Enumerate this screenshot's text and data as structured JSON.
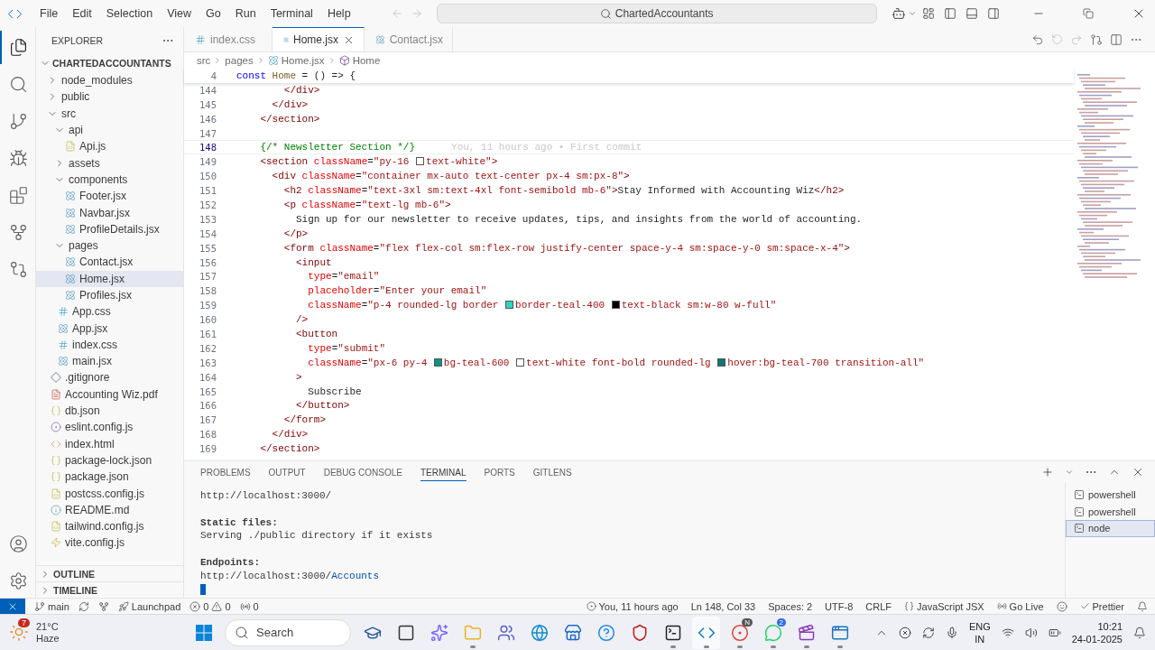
{
  "menu": [
    "File",
    "Edit",
    "Selection",
    "View",
    "Go",
    "Run",
    "Terminal",
    "Help"
  ],
  "command_center": {
    "value": "ChartedAccountants"
  },
  "activity_bar": [
    {
      "kind": "files",
      "selected": true
    },
    {
      "kind": "search",
      "selected": false
    },
    {
      "kind": "source-control",
      "selected": false
    },
    {
      "kind": "run",
      "selected": false
    },
    {
      "kind": "extensions",
      "selected": false
    },
    {
      "kind": "gitlens",
      "selected": false
    },
    {
      "kind": "graph",
      "selected": false
    }
  ],
  "explorer": {
    "title": "EXPLORER",
    "root": "CHARTEDACCOUNTANTS",
    "items": [
      {
        "name": "node_modules",
        "kind": "folder",
        "expanded": false,
        "selected": false
      },
      {
        "name": "public",
        "kind": "folder",
        "expanded": false,
        "selected": false
      },
      {
        "name": "src",
        "kind": "folder",
        "expanded": true,
        "selected": false,
        "children": [
          {
            "name": "api",
            "kind": "folder",
            "expanded": true,
            "selected": false,
            "children": [
              {
                "name": "Api.js",
                "kind": "js",
                "selected": false
              }
            ]
          },
          {
            "name": "assets",
            "kind": "folder",
            "expanded": false,
            "selected": false
          },
          {
            "name": "components",
            "kind": "folder",
            "expanded": true,
            "selected": false,
            "children": [
              {
                "name": "Footer.jsx",
                "kind": "react",
                "selected": false
              },
              {
                "name": "Navbar.jsx",
                "kind": "react",
                "selected": false
              },
              {
                "name": "ProfileDetails.jsx",
                "kind": "react",
                "selected": false
              }
            ]
          },
          {
            "name": "pages",
            "kind": "folder",
            "expanded": true,
            "selected": false,
            "children": [
              {
                "name": "Contact.jsx",
                "kind": "react",
                "selected": false
              },
              {
                "name": "Home.jsx",
                "kind": "react",
                "selected": true
              },
              {
                "name": "Profiles.jsx",
                "kind": "react",
                "selected": false
              }
            ]
          },
          {
            "name": "App.css",
            "kind": "css",
            "selected": false
          },
          {
            "name": "App.jsx",
            "kind": "react",
            "selected": false
          },
          {
            "name": "index.css",
            "kind": "css",
            "selected": false
          },
          {
            "name": "main.jsx",
            "kind": "react",
            "selected": false
          }
        ]
      },
      {
        "name": ".gitignore",
        "kind": "git",
        "selected": false
      },
      {
        "name": "Accounting Wiz.pdf",
        "kind": "pdf",
        "selected": false
      },
      {
        "name": "db.json",
        "kind": "json",
        "selected": false
      },
      {
        "name": "eslint.config.js",
        "kind": "eslint",
        "selected": false
      },
      {
        "name": "index.html",
        "kind": "html",
        "selected": false
      },
      {
        "name": "package-lock.json",
        "kind": "json",
        "selected": false
      },
      {
        "name": "package.json",
        "kind": "json",
        "selected": false
      },
      {
        "name": "postcss.config.js",
        "kind": "js",
        "selected": false
      },
      {
        "name": "README.md",
        "kind": "info",
        "selected": false
      },
      {
        "name": "tailwind.config.js",
        "kind": "js",
        "selected": false
      },
      {
        "name": "vite.config.js",
        "kind": "vite",
        "selected": false
      }
    ],
    "sections": [
      {
        "title": "OUTLINE",
        "expanded": false
      },
      {
        "title": "TIMELINE",
        "expanded": false
      }
    ]
  },
  "tabs": [
    {
      "label": "index.css",
      "kind": "css",
      "selected": false
    },
    {
      "label": "Home.jsx",
      "kind": "react",
      "selected": true
    },
    {
      "label": "Contact.jsx",
      "kind": "react",
      "selected": false
    }
  ],
  "breadcrumbs": [
    {
      "label": "src",
      "kind": "folder"
    },
    {
      "label": "pages",
      "kind": "folder"
    },
    {
      "label": "Home.jsx",
      "kind": "react"
    },
    {
      "label": "Home",
      "kind": "symbol"
    }
  ],
  "sticky_line": {
    "n": "4",
    "tokens": [
      {
        "kind": "kw",
        "text": "const "
      },
      {
        "kind": "fn",
        "text": "Home"
      },
      {
        "kind": "op",
        "text": " = () => {"
      }
    ]
  },
  "code": [
    {
      "n": "144",
      "current": false,
      "tokens": [
        {
          "kind": "tag",
          "text": "        </div>"
        }
      ]
    },
    {
      "n": "145",
      "current": false,
      "tokens": [
        {
          "kind": "tag",
          "text": "      </div>"
        }
      ]
    },
    {
      "n": "146",
      "current": false,
      "tokens": [
        {
          "kind": "tag",
          "text": "    </section>"
        }
      ]
    },
    {
      "n": "147",
      "current": false
    },
    {
      "n": "148",
      "current": true,
      "tokens": [
        {
          "kind": "comment",
          "text": "    {/* Newsletter Section */}"
        }
      ],
      "blame": "You, 11 hours ago • First commit"
    },
    {
      "n": "149",
      "current": false,
      "tokens": [
        {
          "kind": "tag",
          "text": "    <section"
        },
        {
          "kind": "attr",
          "text": " className"
        },
        {
          "kind": "op",
          "text": "="
        },
        {
          "kind": "str",
          "text": "\"py-16 "
        },
        {
          "kind": "swatch",
          "color": "#ffffff"
        },
        {
          "kind": "str",
          "text": "text-white\""
        },
        {
          "kind": "tag",
          "text": ">"
        }
      ]
    },
    {
      "n": "150",
      "current": false,
      "tokens": [
        {
          "kind": "tag",
          "text": "      <div"
        },
        {
          "kind": "attr",
          "text": " className"
        },
        {
          "kind": "op",
          "text": "="
        },
        {
          "kind": "str",
          "text": "\"container mx-auto text-center px-4 sm:px-8\""
        },
        {
          "kind": "tag",
          "text": ">"
        }
      ]
    },
    {
      "n": "151",
      "current": false,
      "tokens": [
        {
          "kind": "tag",
          "text": "        <h2"
        },
        {
          "kind": "attr",
          "text": " className"
        },
        {
          "kind": "op",
          "text": "="
        },
        {
          "kind": "str",
          "text": "\"text-3xl sm:text-4xl font-semibold mb-6\""
        },
        {
          "kind": "tag",
          "text": ">"
        },
        {
          "kind": "text",
          "text": "Stay Informed with Accounting Wiz"
        },
        {
          "kind": "tag",
          "text": "</h2>"
        }
      ]
    },
    {
      "n": "152",
      "current": false,
      "tokens": [
        {
          "kind": "tag",
          "text": "        <p"
        },
        {
          "kind": "attr",
          "text": " className"
        },
        {
          "kind": "op",
          "text": "="
        },
        {
          "kind": "str",
          "text": "\"text-lg mb-6\""
        },
        {
          "kind": "tag",
          "text": ">"
        }
      ]
    },
    {
      "n": "153",
      "current": false,
      "tokens": [
        {
          "kind": "text",
          "text": "          Sign up for our newsletter to receive updates, tips, and insights from the world of accounting."
        }
      ]
    },
    {
      "n": "154",
      "current": false,
      "tokens": [
        {
          "kind": "tag",
          "text": "        </p>"
        }
      ]
    },
    {
      "n": "155",
      "current": false,
      "tokens": [
        {
          "kind": "tag",
          "text": "        <form"
        },
        {
          "kind": "attr",
          "text": " className"
        },
        {
          "kind": "op",
          "text": "="
        },
        {
          "kind": "str",
          "text": "\"flex flex-col sm:flex-row justify-center space-y-4 sm:space-y-0 sm:space-x-4\""
        },
        {
          "kind": "tag",
          "text": ">"
        }
      ]
    },
    {
      "n": "156",
      "current": false,
      "tokens": [
        {
          "kind": "tag",
          "text": "          <input"
        }
      ]
    },
    {
      "n": "157",
      "current": false,
      "tokens": [
        {
          "kind": "attr",
          "text": "            type"
        },
        {
          "kind": "op",
          "text": "="
        },
        {
          "kind": "str",
          "text": "\"email\""
        }
      ]
    },
    {
      "n": "158",
      "current": false,
      "tokens": [
        {
          "kind": "attr",
          "text": "            placeholder"
        },
        {
          "kind": "op",
          "text": "="
        },
        {
          "kind": "str",
          "text": "\"Enter your email\""
        }
      ]
    },
    {
      "n": "159",
      "current": false,
      "tokens": [
        {
          "kind": "attr",
          "text": "            className"
        },
        {
          "kind": "op",
          "text": "="
        },
        {
          "kind": "str",
          "text": "\"p-4 rounded-lg border "
        },
        {
          "kind": "swatch",
          "color": "#2dd4bf"
        },
        {
          "kind": "str",
          "text": "border-teal-400 "
        },
        {
          "kind": "swatch",
          "color": "#000000"
        },
        {
          "kind": "str",
          "text": "text-black sm:w-80 w-full\""
        }
      ]
    },
    {
      "n": "160",
      "current": false,
      "tokens": [
        {
          "kind": "tag",
          "text": "          />"
        }
      ]
    },
    {
      "n": "161",
      "current": false,
      "tokens": [
        {
          "kind": "tag",
          "text": "          <button"
        }
      ]
    },
    {
      "n": "162",
      "current": false,
      "tokens": [
        {
          "kind": "attr",
          "text": "            type"
        },
        {
          "kind": "op",
          "text": "="
        },
        {
          "kind": "str",
          "text": "\"submit\""
        }
      ]
    },
    {
      "n": "163",
      "current": false,
      "tokens": [
        {
          "kind": "attr",
          "text": "            className"
        },
        {
          "kind": "op",
          "text": "="
        },
        {
          "kind": "str",
          "text": "\"px-6 py-4 "
        },
        {
          "kind": "swatch",
          "color": "#0d9488"
        },
        {
          "kind": "str",
          "text": "bg-teal-600 "
        },
        {
          "kind": "swatch",
          "color": "#ffffff"
        },
        {
          "kind": "str",
          "text": "text-white font-bold rounded-lg "
        },
        {
          "kind": "swatch",
          "color": "#0f766e"
        },
        {
          "kind": "str",
          "text": "hover:bg-teal-700 transition-all\""
        }
      ]
    },
    {
      "n": "164",
      "current": false,
      "tokens": [
        {
          "kind": "tag",
          "text": "          >"
        }
      ]
    },
    {
      "n": "165",
      "current": false,
      "tokens": [
        {
          "kind": "text",
          "text": "            Subscribe"
        }
      ]
    },
    {
      "n": "166",
      "current": false,
      "tokens": [
        {
          "kind": "tag",
          "text": "          </button>"
        }
      ]
    },
    {
      "n": "167",
      "current": false,
      "tokens": [
        {
          "kind": "tag",
          "text": "        </form>"
        }
      ]
    },
    {
      "n": "168",
      "current": false,
      "tokens": [
        {
          "kind": "tag",
          "text": "      </div>"
        }
      ]
    },
    {
      "n": "169",
      "current": false,
      "tokens": [
        {
          "kind": "tag",
          "text": "    </section>"
        }
      ]
    }
  ],
  "panel": {
    "tabs": [
      {
        "label": "PROBLEMS",
        "selected": false
      },
      {
        "label": "OUTPUT",
        "selected": false
      },
      {
        "label": "DEBUG CONSOLE",
        "selected": false
      },
      {
        "label": "TERMINAL",
        "selected": true
      },
      {
        "label": "PORTS",
        "selected": false
      },
      {
        "label": "GITLENS",
        "selected": false
      }
    ],
    "terminal_lines": [
      {
        "kind": "plain",
        "parts": [
          {
            "text": "http://localhost:3000/",
            "link": false
          }
        ]
      },
      {
        "kind": "blank"
      },
      {
        "kind": "bold",
        "parts": [
          {
            "text": "Static files:",
            "link": false
          }
        ]
      },
      {
        "kind": "plain",
        "parts": [
          {
            "text": "Serving ./public directory if it exists",
            "link": false
          }
        ]
      },
      {
        "kind": "blank"
      },
      {
        "kind": "bold",
        "parts": [
          {
            "text": "Endpoints:",
            "link": false
          }
        ]
      },
      {
        "kind": "plain",
        "parts": [
          {
            "text": "http://localhost:3000/",
            "link": false
          },
          {
            "text": "Accounts",
            "link": true
          }
        ]
      }
    ],
    "terminals": [
      {
        "label": "powershell",
        "selected": false
      },
      {
        "label": "powershell",
        "selected": false
      },
      {
        "label": "node",
        "selected": true
      }
    ]
  },
  "status_bar": {
    "branch": "main",
    "launchpad": "Launchpad",
    "errors": "0",
    "warnings": "0",
    "ports": "0",
    "blame": "You, 11 hours ago",
    "position": "Ln 148, Col 33",
    "spaces": "Spaces: 2",
    "encoding": "UTF-8",
    "eol": "CRLF",
    "language": "JavaScript JSX",
    "go_live": "Go Live",
    "prettier": "Prettier"
  },
  "taskbar": {
    "weather": {
      "temp": "21°C",
      "condition": "Haze",
      "badge": "7"
    },
    "search": {
      "placeholder": "Search"
    },
    "apps": [
      {
        "kind": "edu",
        "running": false
      },
      {
        "kind": "taskview",
        "running": false
      },
      {
        "kind": "copilot",
        "running": false
      },
      {
        "kind": "files",
        "running": true
      },
      {
        "kind": "teams",
        "running": false
      },
      {
        "kind": "edge",
        "running": false
      },
      {
        "kind": "store",
        "running": false
      },
      {
        "kind": "help",
        "running": false
      },
      {
        "kind": "shield",
        "running": false
      },
      {
        "kind": "terminal",
        "running": true
      },
      {
        "kind": "vscode",
        "running": true
      },
      {
        "kind": "chrome",
        "running": true,
        "badge": "N"
      },
      {
        "kind": "whatsapp",
        "running": true,
        "badge": "2"
      },
      {
        "kind": "clapper",
        "running": true
      },
      {
        "kind": "window",
        "running": true
      }
    ],
    "language": "ENG",
    "region": "IN",
    "time": "10:21",
    "date": "24-01-2025"
  }
}
